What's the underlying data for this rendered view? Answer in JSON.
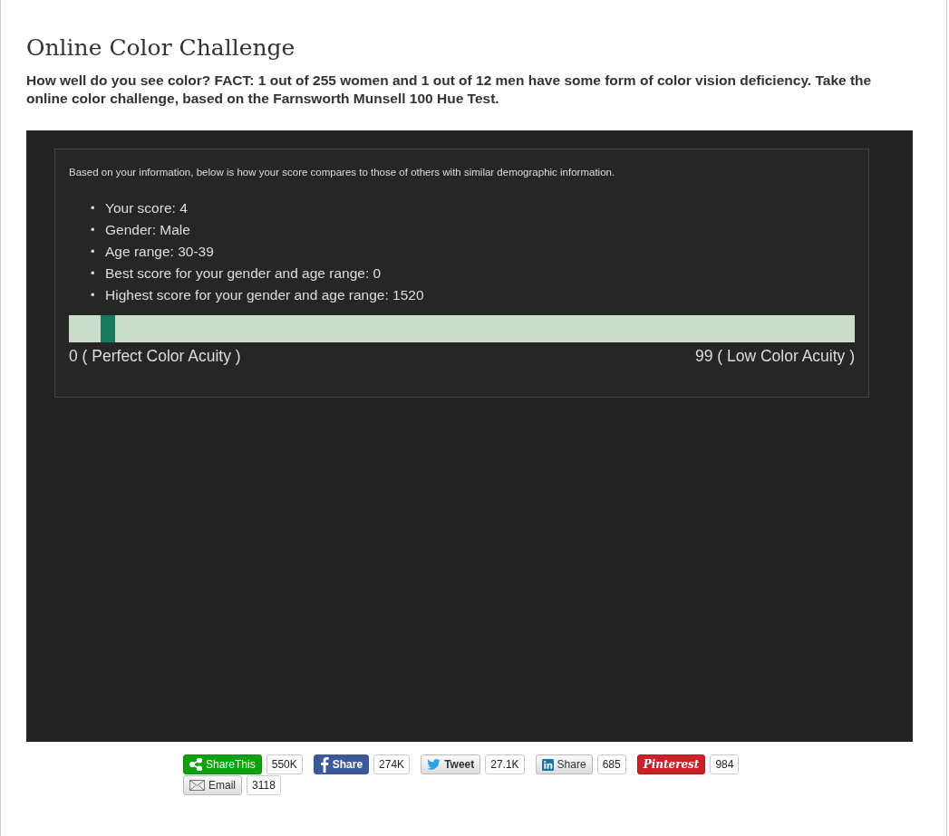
{
  "title": "Online Color Challenge",
  "intro": "How well do you see color? FACT: 1 out of 255 women and 1 out of 12 men have some form of color vision deficiency. Take the online color challenge, based on the Farnsworth Munsell 100 Hue Test.",
  "results": {
    "note": "Based on your information, below is how your score compares to those of others with similar demographic information.",
    "items": [
      {
        "marker": "•",
        "text": "Your score: 4"
      },
      {
        "marker": "•",
        "text": "Gender: Male"
      },
      {
        "marker": "•",
        "text": "Age range: 30-39"
      },
      {
        "marker": "•",
        "text": "Best score for your gender and age range: 0"
      },
      {
        "marker": "•",
        "text": "Highest score for your gender and age range: 1520"
      }
    ],
    "scale": {
      "level": 0.04,
      "min_label": "0 ( Perfect Color Acuity )",
      "max_label": "99 ( Low Color Acuity )"
    }
  },
  "share": [
    {
      "kind": "sharethis",
      "label": "ShareThis",
      "count": "550K"
    },
    {
      "kind": "facebook",
      "label": "Share",
      "count": "274K"
    },
    {
      "kind": "twitter",
      "label": "Tweet",
      "count": "27.1K"
    },
    {
      "kind": "linkedin",
      "label": "Share",
      "count": "685"
    },
    {
      "kind": "pinterest",
      "label": "Pinterest",
      "count": "984"
    },
    {
      "kind": "email",
      "label": "Email",
      "count": "3118"
    }
  ]
}
